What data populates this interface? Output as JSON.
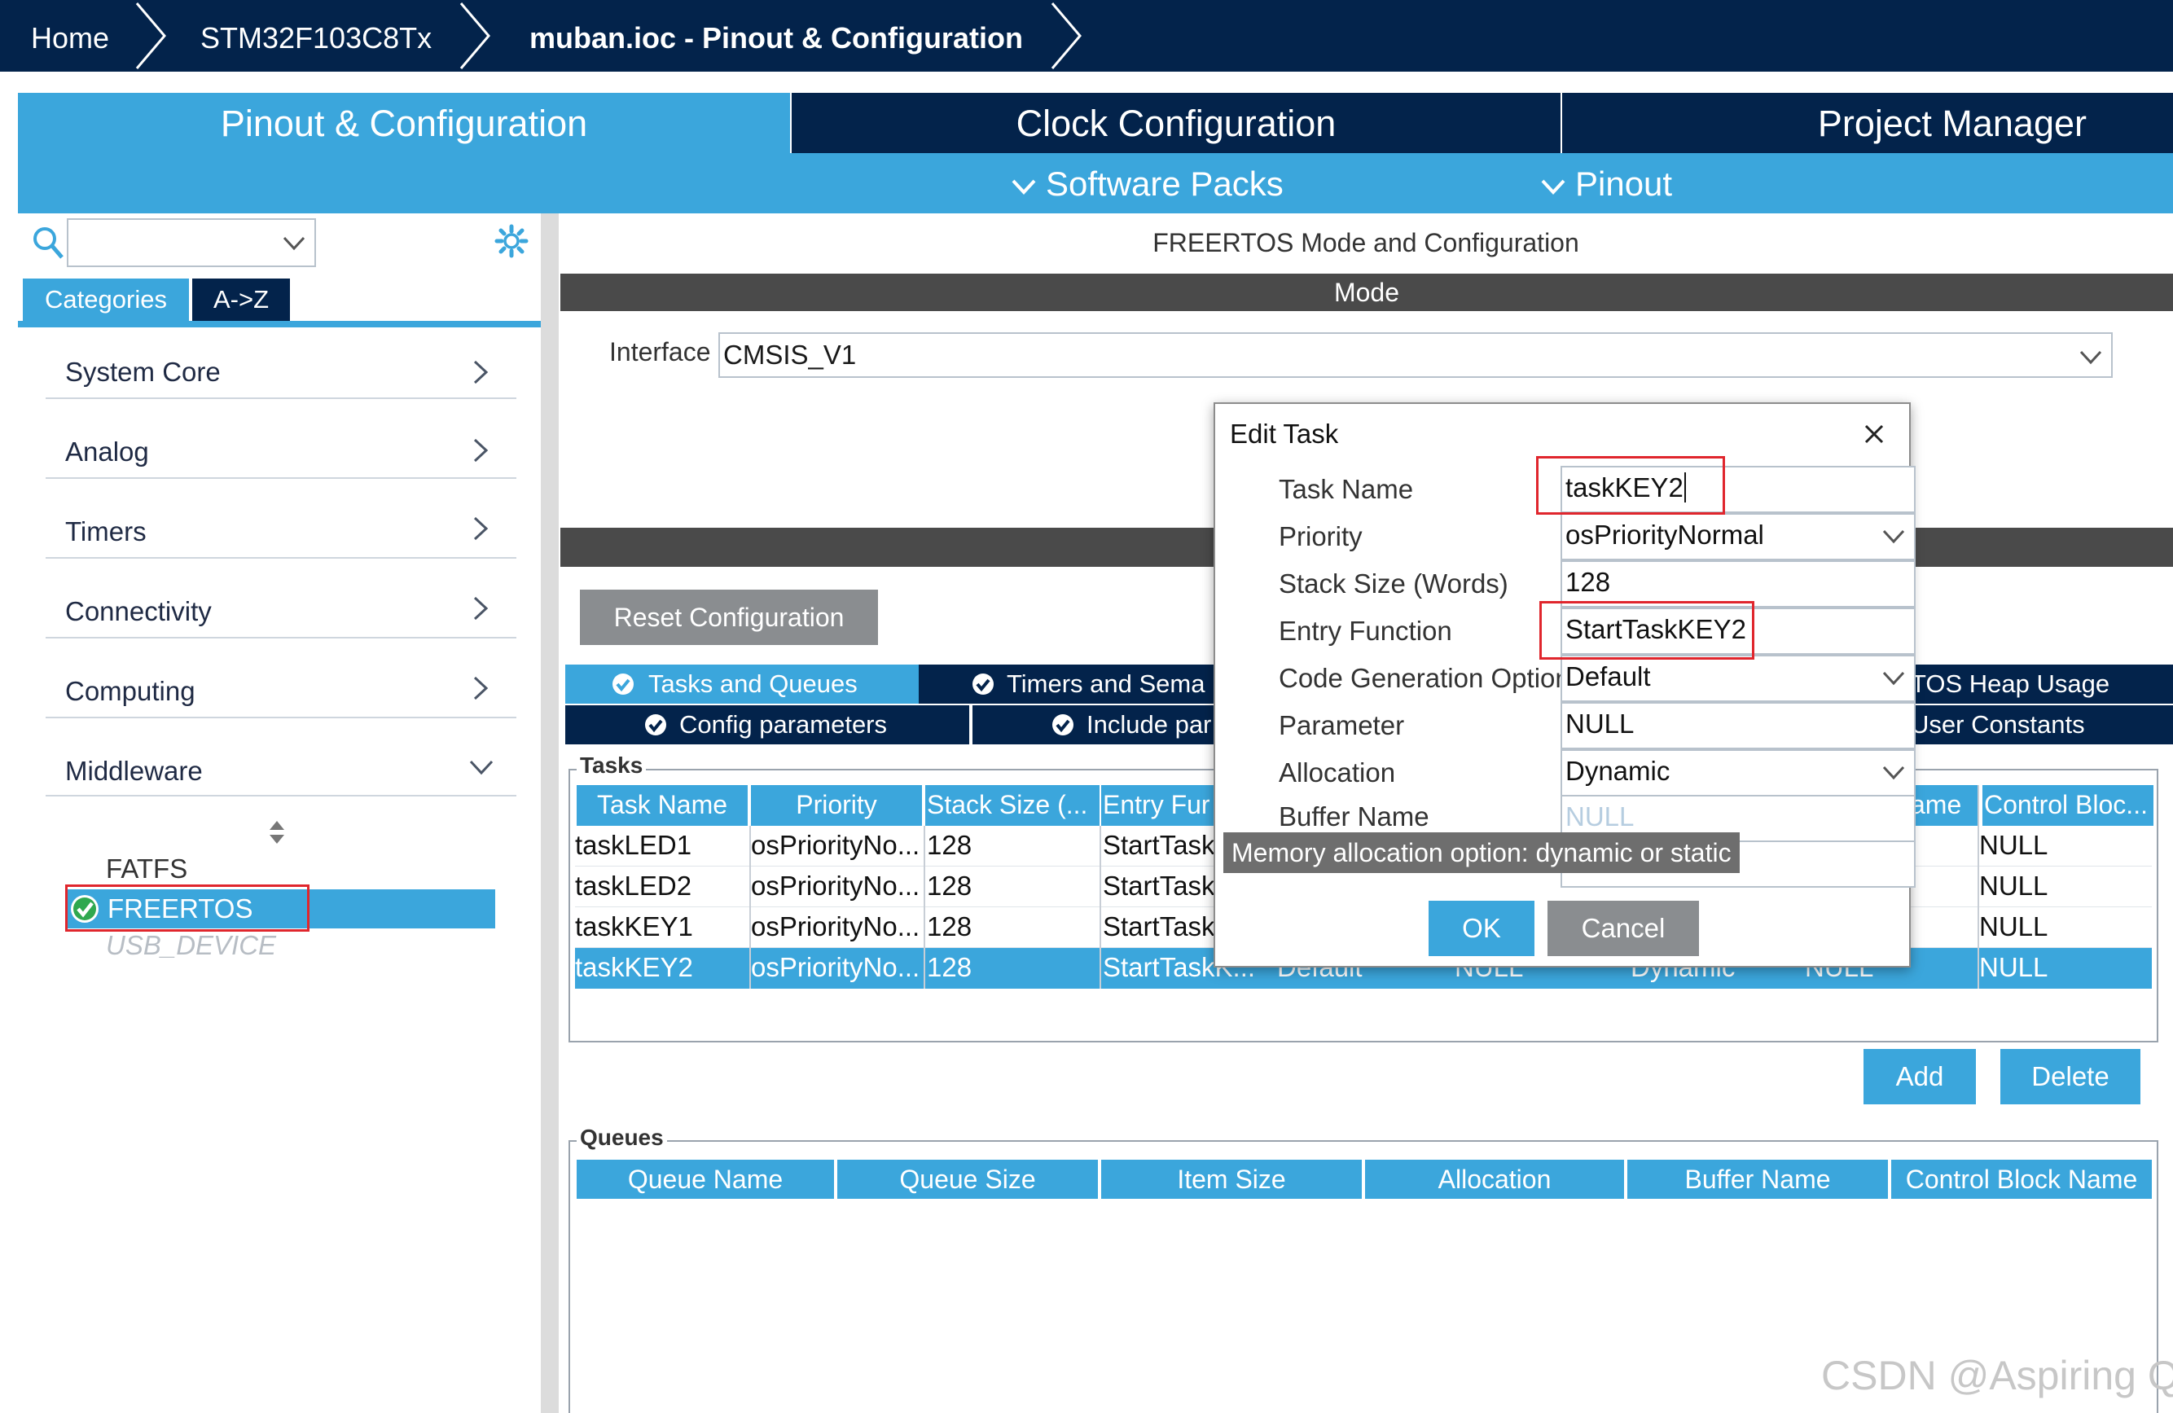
{
  "breadcrumb": {
    "items": [
      "Home",
      "STM32F103C8Tx",
      "muban.ioc - Pinout & Configuration"
    ]
  },
  "tabs": {
    "pinout": "Pinout & Configuration",
    "clock": "Clock Configuration",
    "project": "Project Manager"
  },
  "subtabs": {
    "software_packs": "Software Packs",
    "pinout": "Pinout"
  },
  "sidebar": {
    "search_placeholder": "",
    "tab_categories": "Categories",
    "tab_az": "A->Z",
    "categories": [
      "System Core",
      "Analog",
      "Timers",
      "Connectivity",
      "Computing",
      "Middleware"
    ],
    "middleware_items": [
      "FATFS",
      "FREERTOS",
      "USB_DEVICE"
    ]
  },
  "main": {
    "title": "FREERTOS Mode and Configuration",
    "mode_header": "Mode",
    "interface_label": "Interface",
    "interface_value": "CMSIS_V1",
    "reset_button": "Reset Configuration",
    "config_tabs_row1": [
      "Tasks and Queues",
      "Timers and Sema",
      "TOS Heap Usage"
    ],
    "config_tabs_row2": [
      "Config parameters",
      "Include par",
      "User Constants"
    ],
    "tasks_group": "Tasks",
    "task_columns": [
      "Task Name",
      "Priority",
      "Stack Size (...",
      "Entry Fur",
      "ame",
      "Control Bloc..."
    ],
    "tasks": [
      {
        "name": "taskLED1",
        "priority": "osPriorityNo...",
        "stack": "128",
        "entry": "StartTask",
        "control": "NULL"
      },
      {
        "name": "taskLED2",
        "priority": "osPriorityNo...",
        "stack": "128",
        "entry": "StartTask",
        "control": "NULL"
      },
      {
        "name": "taskKEY1",
        "priority": "osPriorityNo...",
        "stack": "128",
        "entry": "StartTask",
        "control": "NULL"
      },
      {
        "name": "taskKEY2",
        "priority": "osPriorityNo...",
        "stack": "128",
        "entry": "StartTaskK...",
        "codegen": "Default",
        "param": "NULL",
        "alloc": "Dynamic",
        "buffer": "NULL",
        "control": "NULL"
      }
    ],
    "add_button": "Add",
    "delete_button": "Delete",
    "queues_group": "Queues",
    "queue_columns": [
      "Queue Name",
      "Queue Size",
      "Item Size",
      "Allocation",
      "Buffer Name",
      "Control Block Name"
    ]
  },
  "dialog": {
    "title": "Edit Task",
    "fields": [
      {
        "label": "Task Name",
        "value": "taskKEY2"
      },
      {
        "label": "Priority",
        "value": "osPriorityNormal"
      },
      {
        "label": "Stack Size (Words)",
        "value": "128"
      },
      {
        "label": "Entry Function",
        "value": "StartTaskKEY2"
      },
      {
        "label": "Code Generation Option",
        "value": "Default"
      },
      {
        "label": "Parameter",
        "value": "NULL"
      },
      {
        "label": "Allocation",
        "value": "Dynamic"
      },
      {
        "label": "Buffer Name",
        "value": "NULL"
      }
    ],
    "tooltip": "Memory allocation option: dynamic or static",
    "ok": "OK",
    "cancel": "Cancel"
  },
  "watermark": "CSDN @Aspiring Q",
  "colors": {
    "navy": "#03234b",
    "accent": "#3ba6dc",
    "highlight_red": "#e0262d",
    "check_green": "#2fa84f"
  }
}
